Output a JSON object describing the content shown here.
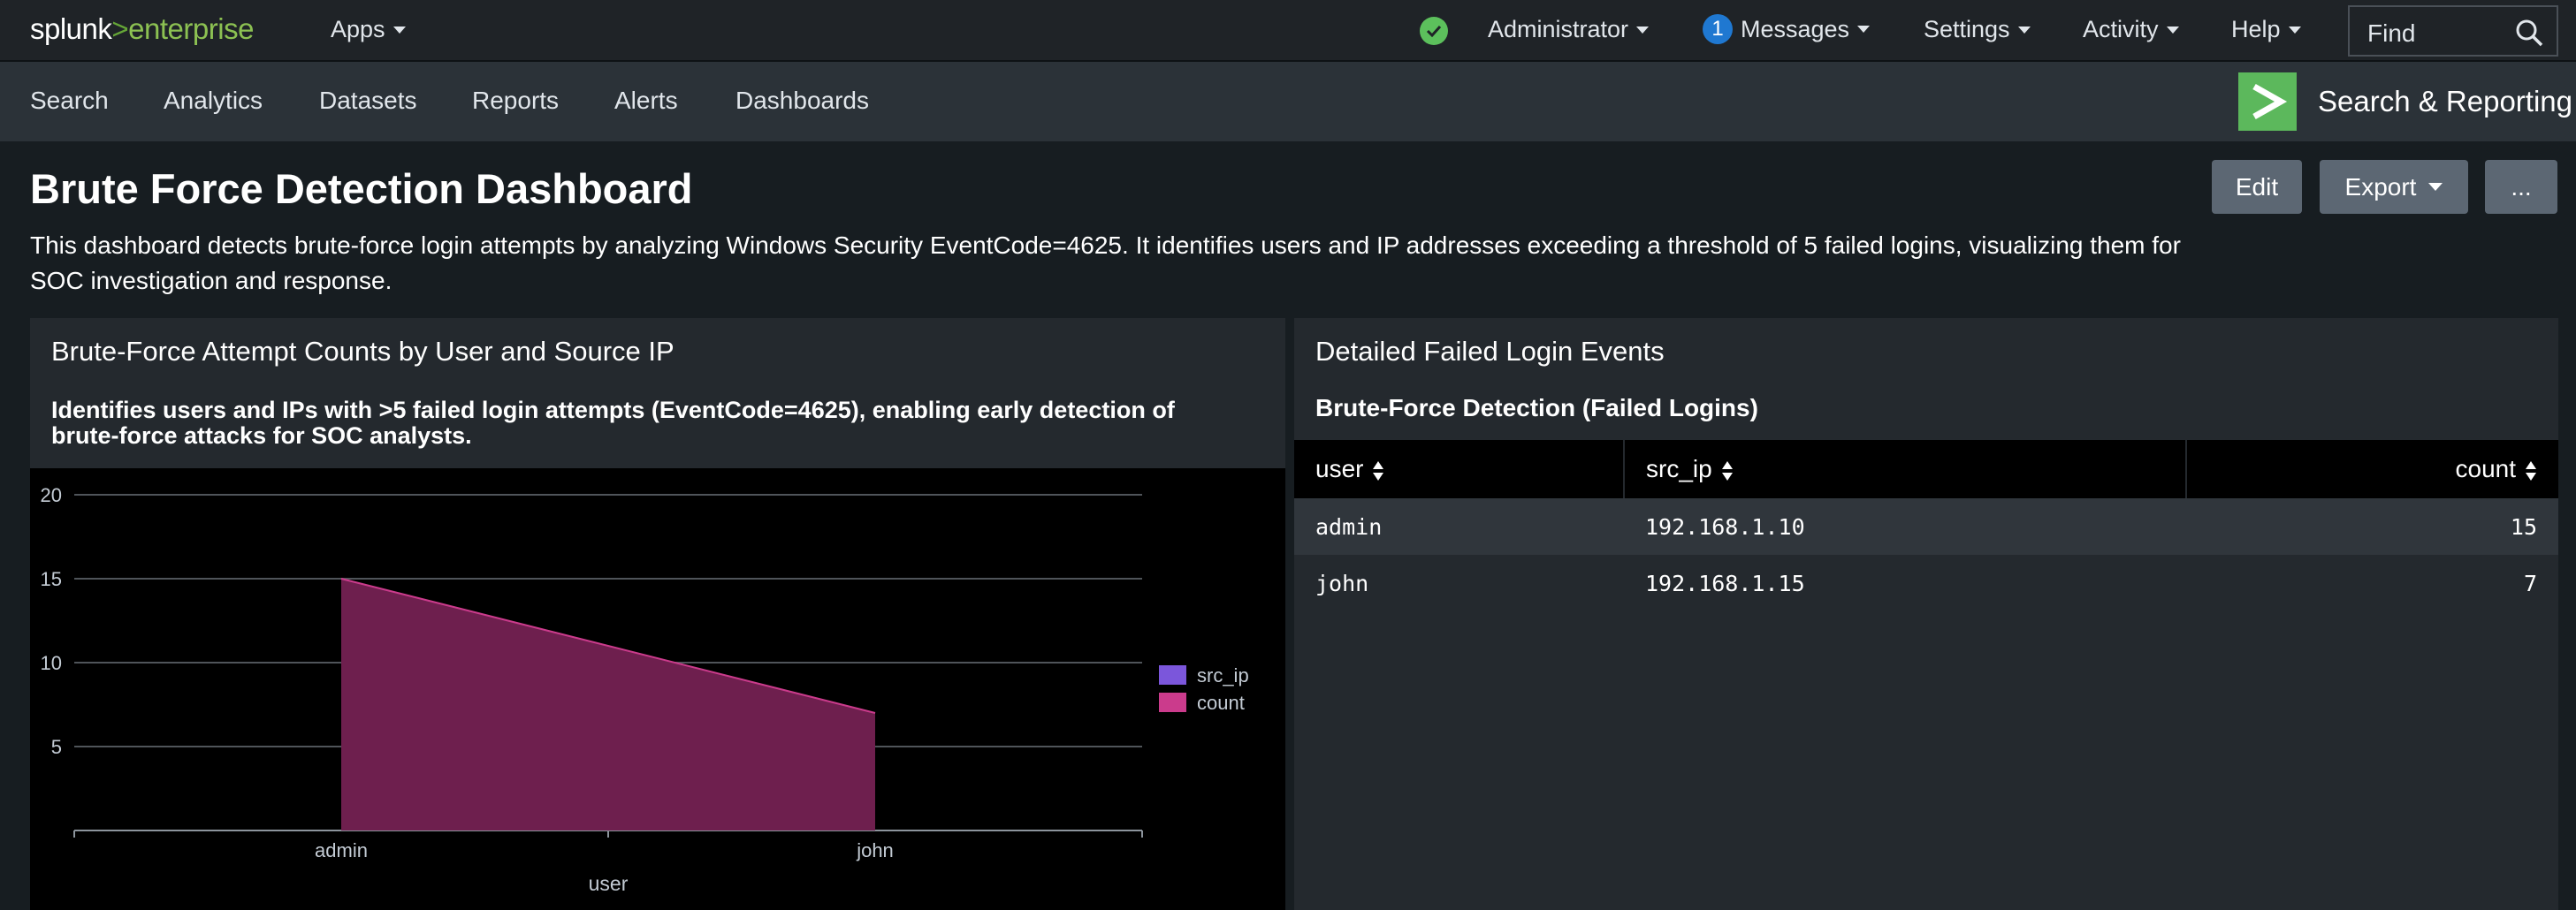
{
  "topbar": {
    "logo_main": "splunk",
    "logo_gt": ">",
    "logo_product": "enterprise",
    "apps_label": "Apps",
    "user_label": "Administrator",
    "messages_count": "1",
    "messages_label": "Messages",
    "settings_label": "Settings",
    "activity_label": "Activity",
    "help_label": "Help",
    "find_label": "Find"
  },
  "appbar": {
    "tabs": [
      "Search",
      "Analytics",
      "Datasets",
      "Reports",
      "Alerts",
      "Dashboards"
    ],
    "app_title": "Search & Reporting"
  },
  "dashboard": {
    "title": "Brute Force Detection Dashboard",
    "description": "This dashboard detects brute-force login attempts by analyzing Windows Security EventCode=4625. It identifies users and IP addresses exceeding a threshold of 5 failed logins, visualizing them for SOC investigation and response.",
    "edit_label": "Edit",
    "export_label": "Export",
    "more_label": "..."
  },
  "left_panel": {
    "title": "Brute-Force Attempt Counts by User and Source IP",
    "description": "Identifies users and IPs with >5 failed login attempts (EventCode=4625), enabling early detection of brute-force attacks for SOC analysts."
  },
  "right_panel": {
    "title": "Detailed Failed Login Events",
    "subtitle": "Brute-Force Detection (Failed Logins)",
    "columns": [
      "user",
      "src_ip",
      "count"
    ],
    "rows": [
      [
        "admin",
        "192.168.1.10",
        "15"
      ],
      [
        "john",
        "192.168.1.15",
        "7"
      ]
    ]
  },
  "chart_data": {
    "type": "area",
    "categories": [
      "admin",
      "john"
    ],
    "series": [
      {
        "name": "src_ip",
        "values": [
          null,
          null
        ],
        "color": "#7b56db"
      },
      {
        "name": "count",
        "values": [
          15,
          7
        ],
        "color": "#cb3b8c"
      }
    ],
    "xlabel": "user",
    "ylabel": "",
    "ylim": [
      0,
      20
    ],
    "yticks": [
      "5",
      "10",
      "15",
      "20"
    ],
    "grid": true,
    "legend_position": "right"
  },
  "colors": {
    "accent_green": "#5cb85c",
    "area_fill": "#6e1f4e",
    "area_stroke": "#cb3b8c"
  }
}
